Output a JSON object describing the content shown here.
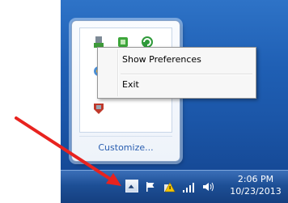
{
  "context_menu": {
    "items": [
      {
        "label": "Show Preferences"
      },
      {
        "label": "Exit"
      }
    ]
  },
  "flyout": {
    "customize_label": "Customize..."
  },
  "taskbar": {
    "clock": {
      "time": "2:06 PM",
      "date": "10/23/2013"
    },
    "tray_icons": [
      "show-hidden-icons-chevron",
      "action-center-flag-icon",
      "power-warning-icon",
      "network-signal-icon",
      "volume-icon"
    ]
  },
  "annotation": {
    "color": "#e8231f"
  }
}
